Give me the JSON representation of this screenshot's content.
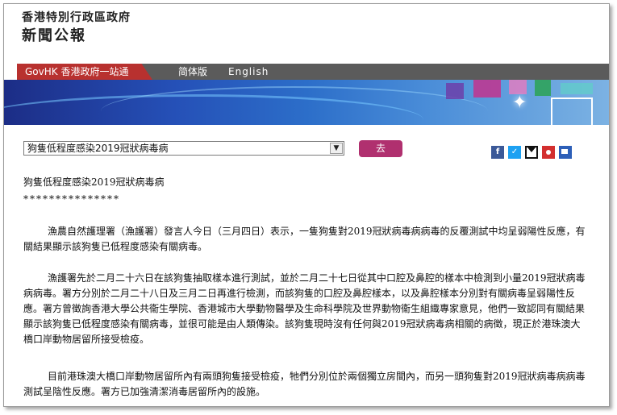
{
  "header": {
    "government_name": "香港特別行政區政府",
    "section_title": "新聞公報"
  },
  "nav": {
    "govhk_label": "GovHK 香港政府一站通",
    "simplified_label": "简体版",
    "english_label": "English"
  },
  "toolbar": {
    "selected_article": "狗隻低程度感染2019冠狀病毒病",
    "go_button_label": "去"
  },
  "share_icons": [
    "facebook-icon",
    "twitter-icon",
    "email-icon",
    "weibo-icon",
    "print-icon"
  ],
  "article": {
    "headline": "狗隻低程度感染2019冠狀病毒病",
    "separator": "***************",
    "paragraphs": [
      "漁農自然護理署（漁護署）發言人今日（三月四日）表示，一隻狗隻對2019冠狀病毒病病毒的反覆測試中均呈弱陽性反應，有關結果顯示該狗隻已低程度感染有關病毒。",
      "漁護署先於二月二十六日在該狗隻抽取樣本進行測試，並於二月二十七日從其中口腔及鼻腔的樣本中檢測到小量2019冠狀病毒病病毒。署方分別於二月二十八日及三月二日再進行檢測，而該狗隻的口腔及鼻腔樣本，以及鼻腔樣本分別對有關病毒呈弱陽性反應。署方曾徵詢香港大學公共衞生學院、香港城市大學動物醫學及生命科學院及世界動物衞生組織專家意見，他們一致認同有關結果顯示該狗隻已低程度感染有關病毒，並很可能是由人類傳染。該狗隻現時沒有任何與2019冠狀病毒病相關的病徵，現正於港珠澳大橋口岸動物居留所接受檢疫。",
      "目前港珠澳大橋口岸動物居留所內有兩頭狗隻接受檢疫，牠們分別位於兩個獨立房間內，而另一頭狗隻對2019冠狀病毒病病毒測試呈陰性反應。署方已加強清潔消毒居留所內的設施。"
    ]
  }
}
